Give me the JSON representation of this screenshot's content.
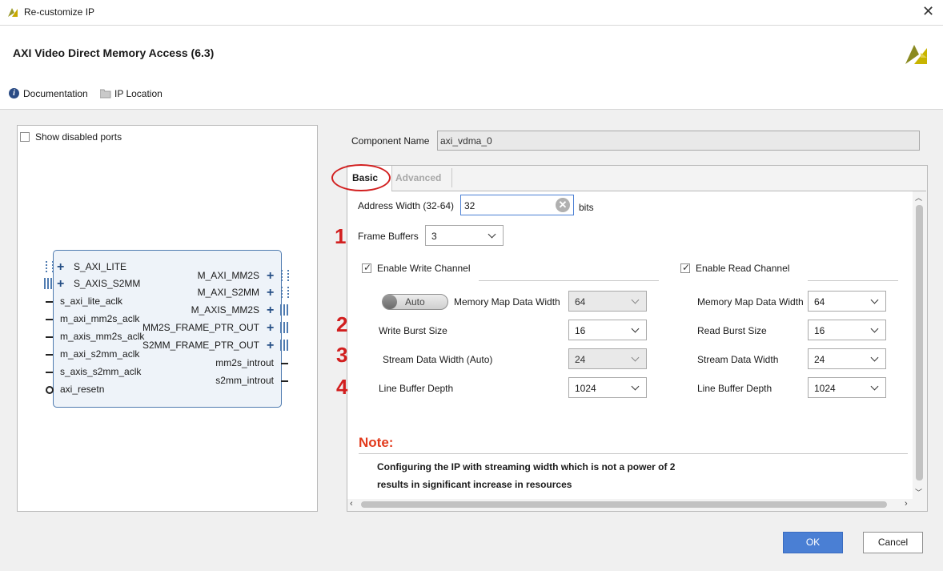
{
  "window": {
    "title": "Re-customize IP",
    "ip_title": "AXI Video Direct Memory Access (6.3)"
  },
  "header_links": {
    "documentation": "Documentation",
    "ip_location": "IP Location"
  },
  "left": {
    "show_disabled_label": "Show disabled ports",
    "ports_left": [
      "S_AXI_LITE",
      "S_AXIS_S2MM",
      "s_axi_lite_aclk",
      "m_axi_mm2s_aclk",
      "m_axis_mm2s_aclk",
      "m_axi_s2mm_aclk",
      "s_axis_s2mm_aclk",
      "axi_resetn"
    ],
    "ports_right": [
      "M_AXI_MM2S",
      "M_AXI_S2MM",
      "M_AXIS_MM2S",
      "MM2S_FRAME_PTR_OUT",
      "S2MM_FRAME_PTR_OUT",
      "mm2s_introut",
      "s2mm_introut"
    ]
  },
  "component": {
    "label": "Component Name",
    "value": "axi_vdma_0"
  },
  "tabs": {
    "basic": "Basic",
    "advanced": "Advanced"
  },
  "basic": {
    "address_width_label": "Address Width (32-64)",
    "address_width_value": "32",
    "bits": "bits",
    "frame_buffers_label": "Frame Buffers",
    "frame_buffers_value": "3",
    "write": {
      "enable_label": "Enable Write Channel",
      "auto_label": "Auto",
      "mm_width_label": "Memory Map Data Width",
      "mm_width_value": "64",
      "burst_label": "Write Burst Size",
      "burst_value": "16",
      "stream_label": "Stream Data Width (Auto)",
      "stream_value": "24",
      "line_label": "Line Buffer Depth",
      "line_value": "1024"
    },
    "read": {
      "enable_label": "Enable Read Channel",
      "mm_width_label": "Memory Map Data Width",
      "mm_width_value": "64",
      "burst_label": "Read Burst Size",
      "burst_value": "16",
      "stream_label": "Stream Data Width",
      "stream_value": "24",
      "line_label": "Line Buffer Depth",
      "line_value": "1024"
    },
    "note_title": "Note:",
    "note_line1": "Configuring the IP with streaming width which is not a power of 2",
    "note_line2": "results in significant increase in resources"
  },
  "annotations": {
    "n1": "1",
    "n2": "2",
    "n3": "3",
    "n4": "4"
  },
  "buttons": {
    "ok": "OK",
    "cancel": "Cancel"
  },
  "colors": {
    "accent": "#4a7fd4",
    "annotation_red": "#d21f1f",
    "ip_block_border": "#4f7bb0"
  }
}
